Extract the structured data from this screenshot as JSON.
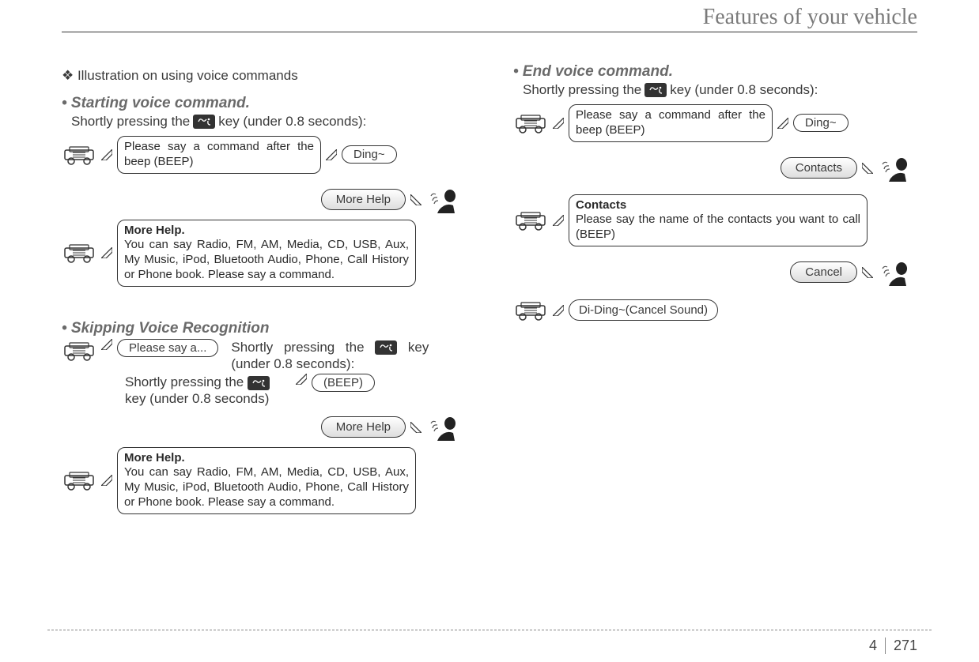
{
  "header": {
    "title": "Features of your vehicle"
  },
  "left": {
    "intro": "❖ Illustration on using voice commands",
    "sec1": {
      "title": "• Starting voice command.",
      "sub_pre": "Shortly pressing the ",
      "sub_post": " key (under 0.8 seconds):",
      "prompt": "Please say a command after the beep (BEEP)",
      "ding": "Ding~",
      "more_help_pill": "More Help",
      "more_help_title": "More Help.",
      "more_help_body": "You can say Radio, FM, AM, Media, CD, USB, Aux, My Music, iPod, Bluetooth Audio, Phone, Call History or Phone book. Please say a command."
    },
    "sec2": {
      "title": "• Skipping Voice Recognition",
      "please_say": "Please say a...",
      "right_text_pre": "Shortly pressing the ",
      "right_text_post": " key (under 0.8 seconds):",
      "second_line_pre": "Shortly pressing the ",
      "second_line_post": " key (under 0.8 seconds)",
      "beep": "(BEEP)",
      "more_help_pill": "More Help",
      "more_help_title": "More Help.",
      "more_help_body": "You can say Radio, FM, AM, Media, CD, USB, Aux, My Music, iPod, Bluetooth Audio, Phone, Call History or Phone book. Please say a command."
    }
  },
  "right": {
    "sec3": {
      "title": "• End voice command.",
      "sub_pre": "Shortly pressing the ",
      "sub_post": " key (under 0.8 seconds):",
      "prompt": "Please say a command after the beep (BEEP)",
      "ding": "Ding~",
      "contacts_pill": "Contacts",
      "contacts_title": "Contacts",
      "contacts_body": "Please say the name of the contacts you want to call (BEEP)",
      "cancel_pill": "Cancel",
      "cancel_sound": "Di-Ding~(Cancel Sound)"
    }
  },
  "footer": {
    "section": "4",
    "page": "271"
  }
}
